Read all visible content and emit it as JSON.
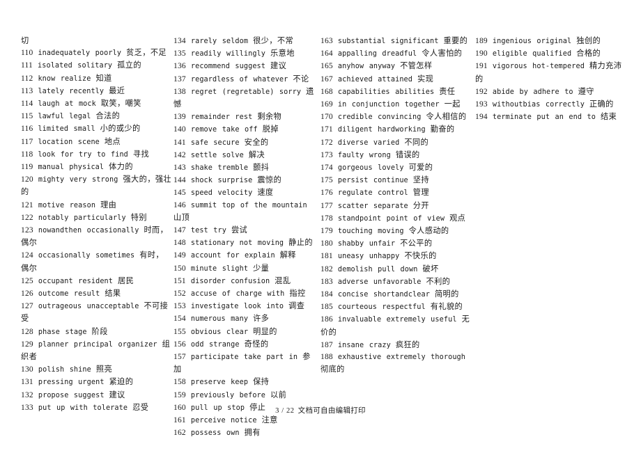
{
  "document": {
    "type": "vocabulary-synonym-list",
    "footer": {
      "page_number": "3 / 22",
      "note": "文档可自由编辑打印"
    }
  },
  "columns": [
    {
      "id": "column-1",
      "lead_orphan": "切",
      "entries": [
        {
          "num": "110",
          "en": "inadequately   poorly",
          "cn": "贫乏，不足"
        },
        {
          "num": "111",
          "en": "isolated   solitary",
          "cn": "孤立的"
        },
        {
          "num": "112",
          "en": "know   realize",
          "cn": "知道"
        },
        {
          "num": "113",
          "en": "lately   recently",
          "cn": "最近"
        },
        {
          "num": "114",
          "en": "laugh at   mock",
          "cn": "取笑，嘲笑"
        },
        {
          "num": "115",
          "en": "lawful   legal",
          "cn": "合法的"
        },
        {
          "num": "116",
          "en": "limited   small",
          "cn": "小的或少的"
        },
        {
          "num": "117",
          "en": "location   scene",
          "cn": "地点"
        },
        {
          "num": "118",
          "en": "look for   try to find",
          "cn": "寻找"
        },
        {
          "num": "119",
          "en": "manual   physical",
          "cn": "体力的"
        },
        {
          "num": "120",
          "en": "mighty   very strong",
          "cn": "强大的，强壮的"
        },
        {
          "num": "121",
          "en": "motive   reason",
          "cn": "理由"
        },
        {
          "num": "122",
          "en": "notably   particularly",
          "cn": "特别"
        },
        {
          "num": "123",
          "en": "nowandthen   occasionally",
          "cn": "时而，偶尔"
        },
        {
          "num": "124",
          "en": "occasionally   sometimes",
          "cn": "有时，偶尔"
        },
        {
          "num": "125",
          "en": "occupant   resident",
          "cn": "居民"
        },
        {
          "num": "126",
          "en": "outcome   result",
          "cn": "结果"
        },
        {
          "num": "127",
          "en": "outrageous   unacceptable",
          "cn": "不可接受"
        },
        {
          "num": "128",
          "en": "phase   stage",
          "cn": "阶段"
        },
        {
          "num": "129",
          "en": "planner   principal organizer",
          "cn": "组织者"
        },
        {
          "num": "130",
          "en": "polish   shine",
          "cn": "照亮"
        },
        {
          "num": "131",
          "en": "pressing   urgent",
          "cn": "紧迫的"
        },
        {
          "num": "132",
          "en": "propose   suggest",
          "cn": "建议"
        },
        {
          "num": "133",
          "en": "put up with   tolerate",
          "cn": "忍受"
        }
      ]
    },
    {
      "id": "column-2",
      "lead_orphan": "",
      "entries": [
        {
          "num": "134",
          "en": "rarely   seldom",
          "cn": "很少，不常"
        },
        {
          "num": "135",
          "en": "readily   willingly",
          "cn": "乐意地"
        },
        {
          "num": "136",
          "en": "recommend   suggest",
          "cn": "建议"
        },
        {
          "num": "137",
          "en": "regardless of   whatever",
          "cn": "不论"
        },
        {
          "num": "138",
          "en": "regret (regretable)   sorry",
          "cn": "遗憾"
        },
        {
          "num": "139",
          "en": "remainder   rest",
          "cn": "剩余物"
        },
        {
          "num": "140",
          "en": "remove   take off",
          "cn": "脱掉"
        },
        {
          "num": "141",
          "en": "safe   secure",
          "cn": "安全的"
        },
        {
          "num": "142",
          "en": "settle   solve",
          "cn": "解决"
        },
        {
          "num": "143",
          "en": "shake   tremble",
          "cn": "颤抖"
        },
        {
          "num": "144",
          "en": "shock   surprise",
          "cn": "震惊的"
        },
        {
          "num": "145",
          "en": "speed   velocity",
          "cn": "速度"
        },
        {
          "num": "146",
          "en": "summit   top of the mountain",
          "cn": "山顶"
        },
        {
          "num": "147",
          "en": "test   try",
          "cn": "尝试"
        },
        {
          "num": "148",
          "en": "stationary   not moving",
          "cn": "静止的"
        },
        {
          "num": "149",
          "en": "account for   explain",
          "cn": "解释"
        },
        {
          "num": "150",
          "en": "minute   slight",
          "cn": "少量"
        },
        {
          "num": "151",
          "en": "disorder   confusion",
          "cn": "混乱"
        },
        {
          "num": "152",
          "en": "accuse of   charge with",
          "cn": "指控"
        },
        {
          "num": "153",
          "en": "investigate   look into",
          "cn": "调查"
        },
        {
          "num": "154",
          "en": "numerous   many",
          "cn": "许多"
        },
        {
          "num": "155",
          "en": "obvious   clear",
          "cn": "明显的"
        },
        {
          "num": "156",
          "en": "odd   strange",
          "cn": "奇怪的"
        },
        {
          "num": "157",
          "en": "participate   take part in",
          "cn": "参加"
        },
        {
          "num": "158",
          "en": "preserve   keep",
          "cn": "保持"
        },
        {
          "num": "159",
          "en": "previously   before",
          "cn": "以前"
        },
        {
          "num": "160",
          "en": "pull up   stop",
          "cn": "停止"
        },
        {
          "num": "161",
          "en": "perceive   notice",
          "cn": "注意"
        },
        {
          "num": "162",
          "en": "possess   own",
          "cn": "拥有"
        }
      ]
    },
    {
      "id": "column-3",
      "lead_orphan": "",
      "entries": [
        {
          "num": "163",
          "en": "substantial   significant",
          "cn": "重要的"
        },
        {
          "num": "164",
          "en": "appalling   dreadful",
          "cn": "令人害怕的"
        },
        {
          "num": "165",
          "en": "anyhow   anyway",
          "cn": "不管怎样"
        },
        {
          "num": "167",
          "en": "achieved   attained",
          "cn": "实现"
        },
        {
          "num": "168",
          "en": "capabilities   abilities",
          "cn": "责任"
        },
        {
          "num": "169",
          "en": "in conjunction   together",
          "cn": "一起"
        },
        {
          "num": "170",
          "en": "credible   convincing",
          "cn": "令人相信的"
        },
        {
          "num": "171",
          "en": "diligent   hardworking",
          "cn": "勤奋的"
        },
        {
          "num": "172",
          "en": "diverse   varied",
          "cn": "不同的"
        },
        {
          "num": "173",
          "en": "faulty   wrong",
          "cn": "错误的"
        },
        {
          "num": "174",
          "en": "gorgeous   lovely",
          "cn": "可爱的"
        },
        {
          "num": "175",
          "en": "persist   continue",
          "cn": "坚持"
        },
        {
          "num": "176",
          "en": "regulate   control",
          "cn": "管理"
        },
        {
          "num": "177",
          "en": "scatter   separate",
          "cn": "分开"
        },
        {
          "num": "178",
          "en": "standpoint   point of view",
          "cn": "观点"
        },
        {
          "num": "179",
          "en": "touching   moving",
          "cn": "令人感动的"
        },
        {
          "num": "180",
          "en": "shabby   unfair",
          "cn": "不公平的"
        },
        {
          "num": "181",
          "en": "uneasy   unhappy",
          "cn": "不快乐的"
        },
        {
          "num": "182",
          "en": "demolish   pull down",
          "cn": "破坏"
        },
        {
          "num": "183",
          "en": "adverse   unfavorable",
          "cn": "不利的"
        },
        {
          "num": "184",
          "en": "concise   shortandclear",
          "cn": "简明的"
        },
        {
          "num": "185",
          "en": "courteous   respectful",
          "cn": "有礼貌的"
        },
        {
          "num": "186",
          "en": "invaluable   extremely useful",
          "cn": "无价的"
        },
        {
          "num": "187",
          "en": "insane   crazy",
          "cn": "疯狂的"
        },
        {
          "num": "188",
          "en": "exhaustive   extremely thorough",
          "cn": "彻底的"
        }
      ]
    },
    {
      "id": "column-4",
      "lead_orphan": "",
      "entries": [
        {
          "num": "189",
          "en": "ingenious   original",
          "cn": "独创的"
        },
        {
          "num": "190",
          "en": "eligible   qualified",
          "cn": "合格的"
        },
        {
          "num": "191",
          "en": "vigorous   hot-tempered",
          "cn": "精力充沛的"
        },
        {
          "num": "192",
          "en": "abide by   adhere to",
          "cn": "遵守"
        },
        {
          "num": "193",
          "en": "withoutbias   correctly",
          "cn": "正确的"
        },
        {
          "num": "194",
          "en": "terminate   put an end to",
          "cn": "结束"
        }
      ]
    }
  ]
}
